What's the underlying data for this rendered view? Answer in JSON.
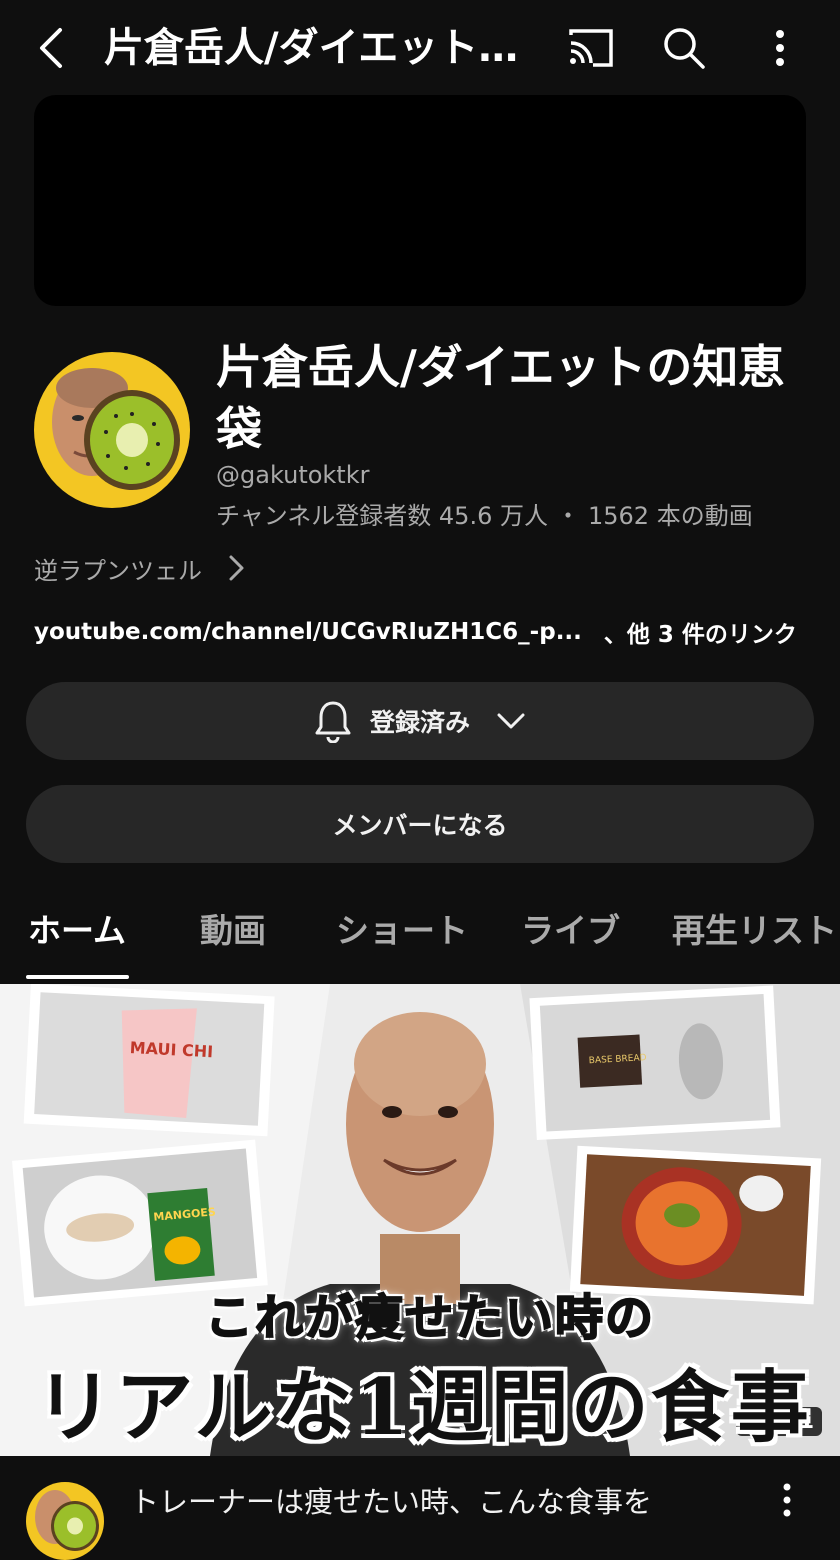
{
  "topbar": {
    "title": "片倉岳人/ダイエットの知恵袋",
    "icons": {
      "back": "back-arrow-icon",
      "cast": "cast-icon",
      "search": "search-icon",
      "more": "more-vert-icon"
    }
  },
  "channel": {
    "name": "片倉岳人/ダイエットの知恵袋",
    "handle": "@gakutoktkr",
    "subscribers_label": "チャンネル登録者数 45.6 万人",
    "stats_separator": "・",
    "videos_label": "1562 本の動画",
    "description": "逆ラプンツェル",
    "link_text": "youtube.com/channel/UCGvRIuZH1C6_-p...",
    "more_links": "、他 3 件のリンク"
  },
  "actions": {
    "subscribed_label": "登録済み",
    "member_label": "メンバーになる"
  },
  "tabs": [
    {
      "label": "ホーム",
      "active": true
    },
    {
      "label": "動画",
      "active": false
    },
    {
      "label": "ショート",
      "active": false
    },
    {
      "label": "ライブ",
      "active": false
    },
    {
      "label": "再生リスト",
      "active": false
    }
  ],
  "featured_video": {
    "caption_line1": "これが痩せたい時の",
    "caption_line2": "リアルな1週間の食事",
    "duration": "15:31",
    "title": "トレーナーは痩せたい時、こんな食事を",
    "snack_label": "MAUI CHI",
    "bread_label": "BASE BREAD",
    "mango_label": "MANGOES"
  },
  "colors": {
    "background": "#0f0f0f",
    "surface": "#272727",
    "secondary_text": "#aaaaaa",
    "avatar_bg": "#f3c623",
    "kiwi_flesh": "#9bbf2a"
  }
}
